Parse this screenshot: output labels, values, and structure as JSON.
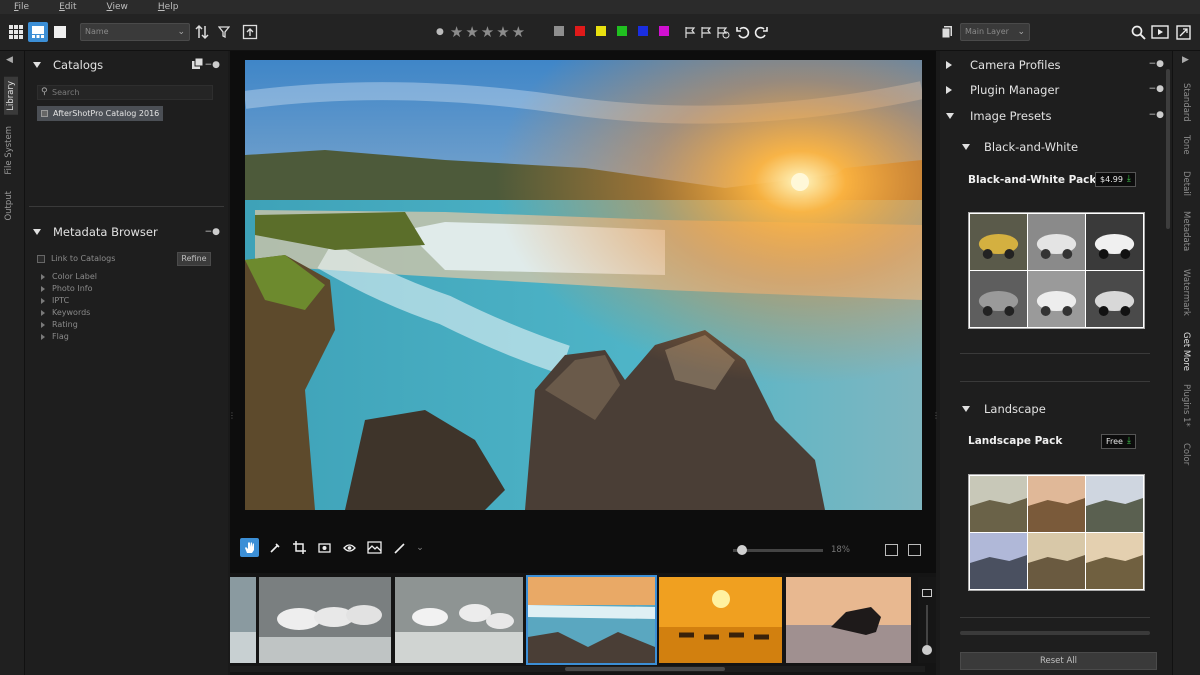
{
  "menu": {
    "items": [
      "File",
      "Edit",
      "View",
      "Help"
    ]
  },
  "toolbar": {
    "sort_select": "Name",
    "layer_select": "Main Layer",
    "color_labels": [
      "#8e8e8e",
      "#e01a1a",
      "#e8e010",
      "#20c020",
      "#1a2ee0",
      "#d010d0"
    ]
  },
  "left_tabs": [
    "Library",
    "File System",
    "Output"
  ],
  "catalogs": {
    "title": "Catalogs",
    "search_placeholder": "Search",
    "items": [
      "AfterShotPro Catalog 2016"
    ]
  },
  "metadata_browser": {
    "title": "Metadata Browser",
    "link_label": "Link to Catalogs",
    "refine_label": "Refine",
    "rows": [
      "Color Label",
      "Photo Info",
      "IPTC",
      "Keywords",
      "Rating",
      "Flag"
    ]
  },
  "viewer": {
    "zoom_level": "18%",
    "zoom_fraction": 0.1
  },
  "right_panel": {
    "sections": [
      "Camera Profiles",
      "Plugin Manager",
      "Image Presets"
    ],
    "subsections": [
      {
        "title": "Black-and-White",
        "pack": "Black-and-White Pack",
        "price": "$4.99"
      },
      {
        "title": "Landscape",
        "pack": "Landscape Pack",
        "price": "Free"
      }
    ],
    "reset_label": "Reset All"
  },
  "right_tabs": [
    "Standard",
    "Tone",
    "Detail",
    "Metadata",
    "Watermark",
    "Get More",
    "Plugins 1*",
    "Color"
  ]
}
